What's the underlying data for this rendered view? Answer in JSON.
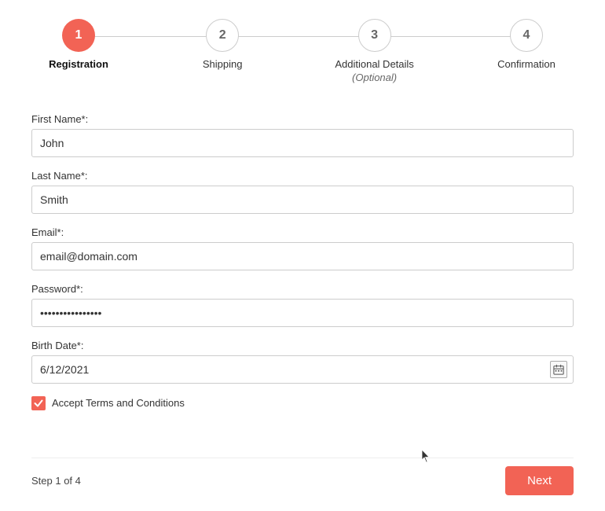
{
  "stepper": {
    "steps": [
      {
        "number": "1",
        "label": "Registration",
        "sublabel": "",
        "state": "active"
      },
      {
        "number": "2",
        "label": "Shipping",
        "sublabel": "",
        "state": "inactive"
      },
      {
        "number": "3",
        "label": "Additional Details",
        "sublabel": "(Optional)",
        "state": "inactive"
      },
      {
        "number": "4",
        "label": "Confirmation",
        "sublabel": "",
        "state": "inactive"
      }
    ]
  },
  "form": {
    "first_name_label": "First Name*:",
    "first_name_value": "John",
    "last_name_label": "Last Name*:",
    "last_name_value": "Smith",
    "email_label": "Email*:",
    "email_value": "email@domain.com",
    "password_label": "Password*:",
    "password_value": "••••••••••••••••••",
    "birth_date_label": "Birth Date*:",
    "birth_date_value": "6/12/2021",
    "terms_label": "Accept Terms and Conditions"
  },
  "footer": {
    "step_indicator": "Step 1 of 4",
    "next_button_label": "Next"
  }
}
